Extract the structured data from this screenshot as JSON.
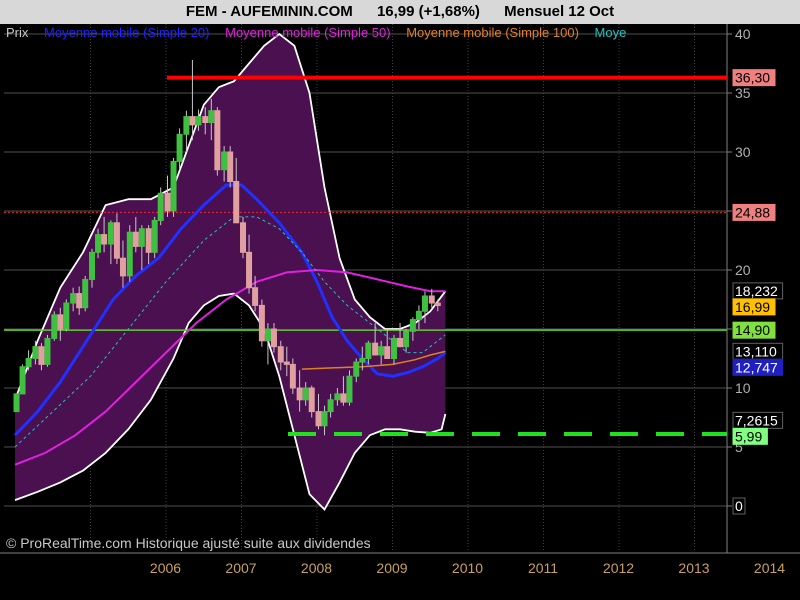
{
  "header": {
    "symbol": "FEM - AUFEMININ.COM",
    "price_change": "16,99 (+1,68%)",
    "period": "Mensuel  12 Oct"
  },
  "legend": [
    {
      "label": "Prix",
      "color": "#c8c8c8"
    },
    {
      "label": "Moyenne mobile (Simple 20)",
      "color": "#2222ff"
    },
    {
      "label": "Moyenne mobile (Simple 50)",
      "color": "#e020e0"
    },
    {
      "label": "Moyenne mobile (Simple 100)",
      "color": "#e08020"
    },
    {
      "label": "Moye",
      "color": "#20c0c0"
    }
  ],
  "footer": {
    "copyright": "© ProRealTime.com Historique ajusté suite aux dividendes"
  },
  "colors": {
    "background": "#000000",
    "band_fill": "#4a1050",
    "up": "#40c040",
    "down": "#e0a0a0"
  },
  "chart_data": {
    "type": "candlestick",
    "x_ticks": [
      "2006",
      "2007",
      "2008",
      "2009",
      "2010",
      "2011",
      "2012",
      "2013",
      "2014"
    ],
    "y_ticks": [
      0,
      5,
      10,
      15,
      20,
      25,
      30,
      35,
      40
    ],
    "ylim": [
      -2,
      41
    ],
    "price_labels": [
      {
        "text": "36,30",
        "value": 36.3,
        "bg": "#f08080",
        "fg": "#000000"
      },
      {
        "text": "24,88",
        "value": 24.88,
        "bg": "#f08080",
        "fg": "#000000"
      },
      {
        "text": "18,232",
        "value": 18.23,
        "bg": "#000000",
        "fg": "#ffffff"
      },
      {
        "text": "16,99",
        "value": 16.99,
        "bg": "#ffc000",
        "fg": "#000000"
      },
      {
        "text": "14,90",
        "value": 14.9,
        "bg": "#80e040",
        "fg": "#000000"
      },
      {
        "text": "13,110",
        "value": 13.11,
        "bg": "#000000",
        "fg": "#ffffff"
      },
      {
        "text": "12,747",
        "value": 12.747,
        "bg": "#2020c0",
        "fg": "#ffffff"
      },
      {
        "text": "7,2615",
        "value": 7.26,
        "bg": "#000000",
        "fg": "#ffffff"
      },
      {
        "text": "5,99",
        "value": 5.99,
        "bg": "#80ff80",
        "fg": "#000000"
      },
      {
        "text": "0",
        "value": 0,
        "bg": "#000000",
        "fg": "#ffffff"
      }
    ],
    "horizontal_lines": [
      {
        "value": 36.3,
        "style": "solid-thick",
        "color": "#ff0000",
        "from": 2007.0
      },
      {
        "value": 24.88,
        "style": "dotted",
        "color": "#ff2020",
        "from": 2005.0
      },
      {
        "value": 14.9,
        "style": "solid",
        "color": "#60d020",
        "from": 2005.0
      },
      {
        "value": 6.1,
        "style": "dashed-thick",
        "color": "#20e020",
        "from": 2008.67
      }
    ],
    "candles": [
      [
        2005.02,
        8,
        9.5,
        8,
        9.5
      ],
      [
        2005.1,
        9.5,
        12,
        9.5,
        11.8
      ],
      [
        2005.18,
        11.8,
        13.2,
        11.5,
        12.5
      ],
      [
        2005.27,
        12.5,
        14,
        12,
        13.5
      ],
      [
        2005.35,
        13.5,
        13.8,
        11.5,
        12
      ],
      [
        2005.43,
        12,
        14.5,
        11.8,
        14.2
      ],
      [
        2005.52,
        14.2,
        16.5,
        14,
        16.2
      ],
      [
        2005.6,
        16.2,
        16.8,
        14,
        15
      ],
      [
        2005.68,
        15,
        17.5,
        14.8,
        17.2
      ],
      [
        2005.77,
        17.2,
        18.5,
        16.5,
        18
      ],
      [
        2005.85,
        18,
        18.6,
        16.2,
        16.8
      ],
      [
        2005.93,
        16.8,
        19.5,
        16.5,
        19.2
      ],
      [
        2006.02,
        19.2,
        21.8,
        18.5,
        21.5
      ],
      [
        2006.1,
        21.5,
        23.5,
        21,
        23
      ],
      [
        2006.18,
        23,
        24.5,
        21.5,
        22.2
      ],
      [
        2006.27,
        22.2,
        24.2,
        20.5,
        24
      ],
      [
        2006.35,
        24,
        24.8,
        20.5,
        21
      ],
      [
        2006.43,
        21,
        22.5,
        18.5,
        19.5
      ],
      [
        2006.52,
        19.5,
        23.8,
        19,
        23.2
      ],
      [
        2006.6,
        23.2,
        24.5,
        21.5,
        22
      ],
      [
        2006.68,
        22,
        23.8,
        20,
        23.5
      ],
      [
        2006.77,
        23.5,
        23.8,
        20.5,
        21.5
      ],
      [
        2006.85,
        21.5,
        24.5,
        21,
        24.2
      ],
      [
        2006.93,
        24.2,
        27,
        23.8,
        26.5
      ],
      [
        2007.02,
        26.5,
        28,
        24.5,
        25
      ],
      [
        2007.1,
        25,
        29.5,
        24.5,
        29.2
      ],
      [
        2007.18,
        29.2,
        32,
        28.5,
        31.5
      ],
      [
        2007.27,
        31.5,
        33.5,
        30,
        33
      ],
      [
        2007.35,
        33,
        37.8,
        31,
        32.3
      ],
      [
        2007.43,
        32.3,
        33.6,
        31.8,
        33
      ],
      [
        2007.52,
        33,
        33.8,
        31.5,
        32.5
      ],
      [
        2007.6,
        32.5,
        34.5,
        31,
        33.5
      ],
      [
        2007.68,
        33.5,
        33.8,
        28,
        28.5
      ],
      [
        2007.77,
        28.5,
        30.5,
        27.5,
        30
      ],
      [
        2007.85,
        30,
        30.5,
        27,
        27.5
      ],
      [
        2007.93,
        27.5,
        29.5,
        26,
        24
      ],
      [
        2008.02,
        24,
        24.5,
        21,
        21.5
      ],
      [
        2008.1,
        21.5,
        23,
        18,
        18.5
      ],
      [
        2008.18,
        18.5,
        19.5,
        16.5,
        17
      ],
      [
        2008.27,
        17,
        17.5,
        13.5,
        14
      ],
      [
        2008.35,
        14,
        15.5,
        12,
        15
      ],
      [
        2008.43,
        15,
        15.5,
        13,
        13.5
      ],
      [
        2008.52,
        13.5,
        14,
        11.5,
        12.2
      ],
      [
        2008.6,
        12.2,
        13.5,
        11,
        12
      ],
      [
        2008.68,
        12,
        12.5,
        9.5,
        10
      ],
      [
        2008.77,
        10,
        11.5,
        8,
        9
      ],
      [
        2008.85,
        9,
        10.5,
        8.5,
        10
      ],
      [
        2008.93,
        10,
        10.2,
        7.5,
        8
      ],
      [
        2009.02,
        8,
        9.5,
        6.5,
        6.8
      ],
      [
        2009.1,
        6.8,
        8.5,
        6,
        8
      ],
      [
        2009.18,
        8,
        9.5,
        7.5,
        9
      ],
      [
        2009.27,
        9,
        10,
        8.5,
        9.5
      ],
      [
        2009.35,
        9.5,
        11,
        8.5,
        8.8
      ],
      [
        2009.43,
        8.8,
        11.5,
        8.5,
        11
      ],
      [
        2009.52,
        11,
        12.5,
        10.5,
        12.2
      ],
      [
        2009.6,
        12.2,
        13.5,
        11.5,
        12.5
      ],
      [
        2009.68,
        12.5,
        14,
        12,
        13.8
      ],
      [
        2009.77,
        13.8,
        15.5,
        13,
        12.8
      ],
      [
        2009.85,
        12.8,
        14,
        12,
        13.5
      ],
      [
        2009.93,
        13.5,
        15,
        12.5,
        12.5
      ],
      [
        2010.02,
        12.5,
        14.5,
        12,
        14.2
      ],
      [
        2010.1,
        14.2,
        15.5,
        13.5,
        13.5
      ],
      [
        2010.18,
        13.5,
        15,
        13,
        14.8
      ],
      [
        2010.27,
        14.8,
        16,
        14,
        15.8
      ],
      [
        2010.35,
        15.8,
        17,
        15,
        16.5
      ],
      [
        2010.43,
        16.5,
        18.2,
        15.5,
        17.8
      ],
      [
        2010.52,
        17.8,
        18.4,
        16.8,
        17.2
      ],
      [
        2010.6,
        17.2,
        17.5,
        16.5,
        16.99
      ]
    ],
    "series": [
      {
        "name": "Moyenne mobile (Simple 20)",
        "color": "#2030ff",
        "width": 3,
        "points": [
          [
            2005.0,
            6
          ],
          [
            2005.3,
            8
          ],
          [
            2005.6,
            10.5
          ],
          [
            2006.0,
            14.5
          ],
          [
            2006.3,
            17.5
          ],
          [
            2006.6,
            19.5
          ],
          [
            2006.9,
            21
          ],
          [
            2007.2,
            23.5
          ],
          [
            2007.5,
            25.5
          ],
          [
            2007.8,
            27.2
          ],
          [
            2008.0,
            27.2
          ],
          [
            2008.2,
            26
          ],
          [
            2008.5,
            24
          ],
          [
            2008.8,
            21.5
          ],
          [
            2009.0,
            19
          ],
          [
            2009.2,
            16
          ],
          [
            2009.4,
            14
          ],
          [
            2009.6,
            12.5
          ],
          [
            2009.8,
            11.2
          ],
          [
            2010.0,
            11
          ],
          [
            2010.2,
            11.3
          ],
          [
            2010.4,
            11.8
          ],
          [
            2010.6,
            12.5
          ],
          [
            2010.7,
            13
          ]
        ]
      },
      {
        "name": "Moyenne mobile (Simple 50)",
        "color": "#e020e0",
        "width": 2,
        "points": [
          [
            2005.0,
            3.5
          ],
          [
            2005.4,
            4.5
          ],
          [
            2005.8,
            6
          ],
          [
            2006.2,
            8
          ],
          [
            2006.6,
            10.5
          ],
          [
            2007.0,
            13
          ],
          [
            2007.4,
            15.5
          ],
          [
            2007.8,
            17.5
          ],
          [
            2008.2,
            19
          ],
          [
            2008.6,
            19.8
          ],
          [
            2009.0,
            20
          ],
          [
            2009.4,
            19.8
          ],
          [
            2009.8,
            19.2
          ],
          [
            2010.2,
            18.6
          ],
          [
            2010.5,
            18.2
          ],
          [
            2010.7,
            18.2
          ]
        ]
      },
      {
        "name": "Moyenne mobile (Simple 100)",
        "color": "#e08020",
        "width": 1.5,
        "points": [
          [
            2008.8,
            11.6
          ],
          [
            2009.2,
            11.7
          ],
          [
            2009.6,
            11.8
          ],
          [
            2010.0,
            12.0
          ],
          [
            2010.3,
            12.4
          ],
          [
            2010.5,
            12.8
          ],
          [
            2010.7,
            13.1
          ]
        ]
      },
      {
        "name": "Moye",
        "color": "#20c0c0",
        "width": 1,
        "dash": "3,3",
        "points": [
          [
            2005.0,
            5
          ],
          [
            2005.5,
            8
          ],
          [
            2006.0,
            11
          ],
          [
            2006.5,
            15
          ],
          [
            2007.0,
            19
          ],
          [
            2007.5,
            22.5
          ],
          [
            2007.9,
            24.5
          ],
          [
            2008.2,
            24.5
          ],
          [
            2008.5,
            23.5
          ],
          [
            2008.8,
            21.5
          ],
          [
            2009.1,
            19
          ],
          [
            2009.4,
            17
          ],
          [
            2009.7,
            15.5
          ],
          [
            2010.0,
            14
          ],
          [
            2010.2,
            13
          ],
          [
            2010.4,
            13
          ],
          [
            2010.6,
            14
          ],
          [
            2010.7,
            14.5
          ]
        ]
      }
    ],
    "band": {
      "upper": [
        [
          2005.0,
          9
        ],
        [
          2005.3,
          14
        ],
        [
          2005.6,
          18.5
        ],
        [
          2005.9,
          21.5
        ],
        [
          2006.2,
          25.5
        ],
        [
          2006.5,
          26
        ],
        [
          2006.8,
          26
        ],
        [
          2007.1,
          27
        ],
        [
          2007.3,
          30.5
        ],
        [
          2007.5,
          34
        ],
        [
          2007.7,
          35.5
        ],
        [
          2007.9,
          36
        ],
        [
          2008.1,
          37.5
        ],
        [
          2008.3,
          39
        ],
        [
          2008.5,
          40
        ],
        [
          2008.7,
          39
        ],
        [
          2008.9,
          35
        ],
        [
          2009.1,
          27
        ],
        [
          2009.3,
          21
        ],
        [
          2009.5,
          17.5
        ],
        [
          2009.7,
          16
        ],
        [
          2009.9,
          15
        ],
        [
          2010.1,
          15
        ],
        [
          2010.3,
          15.5
        ],
        [
          2010.5,
          16.5
        ],
        [
          2010.7,
          18.2
        ]
      ],
      "lower": [
        [
          2005.0,
          0.5
        ],
        [
          2005.3,
          1.2
        ],
        [
          2005.6,
          2
        ],
        [
          2005.9,
          3
        ],
        [
          2006.2,
          4.5
        ],
        [
          2006.5,
          6.5
        ],
        [
          2006.8,
          9
        ],
        [
          2007.1,
          12.5
        ],
        [
          2007.3,
          15.5
        ],
        [
          2007.5,
          17
        ],
        [
          2007.7,
          17.8
        ],
        [
          2007.9,
          18
        ],
        [
          2008.1,
          17
        ],
        [
          2008.3,
          15
        ],
        [
          2008.5,
          11
        ],
        [
          2008.7,
          6
        ],
        [
          2008.9,
          1
        ],
        [
          2009.1,
          -0.3
        ],
        [
          2009.3,
          2
        ],
        [
          2009.5,
          4.5
        ],
        [
          2009.7,
          6
        ],
        [
          2009.9,
          6.5
        ],
        [
          2010.1,
          6.5
        ],
        [
          2010.3,
          6.3
        ],
        [
          2010.5,
          6.2
        ],
        [
          2010.65,
          6.5
        ],
        [
          2010.7,
          7.8
        ]
      ]
    }
  }
}
